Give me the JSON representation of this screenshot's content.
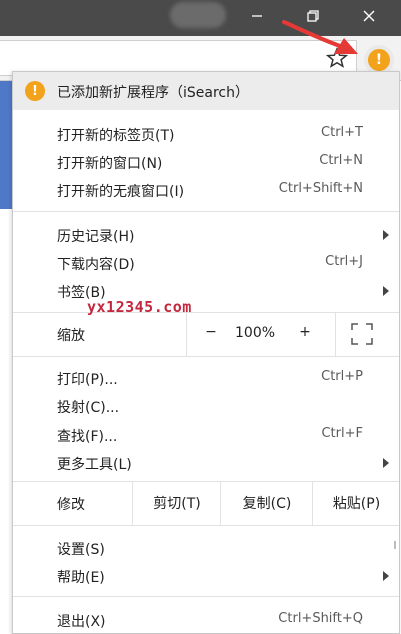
{
  "colors": {
    "accent_warning": "#f3a21b",
    "titlebar": "#4a4a4a",
    "watermark": "#c3283e",
    "page_blue": "#4f79c7"
  },
  "window_controls": {
    "minimize_icon": "minimize-icon",
    "restore_icon": "restore-icon",
    "close_icon": "close-icon"
  },
  "toolbar": {
    "bookmark_icon": "star-icon",
    "extension_icon": "warning-icon",
    "extension_glyph": "!"
  },
  "menu": {
    "notice": {
      "glyph": "!",
      "text": "已添加新扩展程序（iSearch）"
    },
    "group1": [
      {
        "label": "打开新的标签页(T)",
        "shortcut": "Ctrl+T"
      },
      {
        "label": "打开新的窗口(N)",
        "shortcut": "Ctrl+N"
      },
      {
        "label": "打开新的无痕窗口(I)",
        "shortcut": "Ctrl+Shift+N"
      }
    ],
    "group2": [
      {
        "label": "历史记录(H)",
        "shortcut": ""
      },
      {
        "label": "下载内容(D)",
        "shortcut": "Ctrl+J"
      },
      {
        "label": "书签(B)",
        "shortcut": ""
      }
    ],
    "zoom": {
      "label": "缩放",
      "minus": "−",
      "value": "100%",
      "plus": "+"
    },
    "group3": [
      {
        "label": "打印(P)...",
        "shortcut": "Ctrl+P"
      },
      {
        "label": "投射(C)...",
        "shortcut": ""
      },
      {
        "label": "查找(F)...",
        "shortcut": "Ctrl+F"
      },
      {
        "label": "更多工具(L)",
        "shortcut": ""
      }
    ],
    "edit": {
      "label": "修改",
      "cut": "剪切(T)",
      "copy": "复制(C)",
      "paste": "粘贴(P)"
    },
    "group4": [
      {
        "label": "设置(S)",
        "shortcut": ""
      },
      {
        "label": "帮助(E)",
        "shortcut": ""
      }
    ],
    "exit": {
      "label": "退出(X)",
      "shortcut": "Ctrl+Shift+Q"
    }
  },
  "watermark": "yx12345.com"
}
